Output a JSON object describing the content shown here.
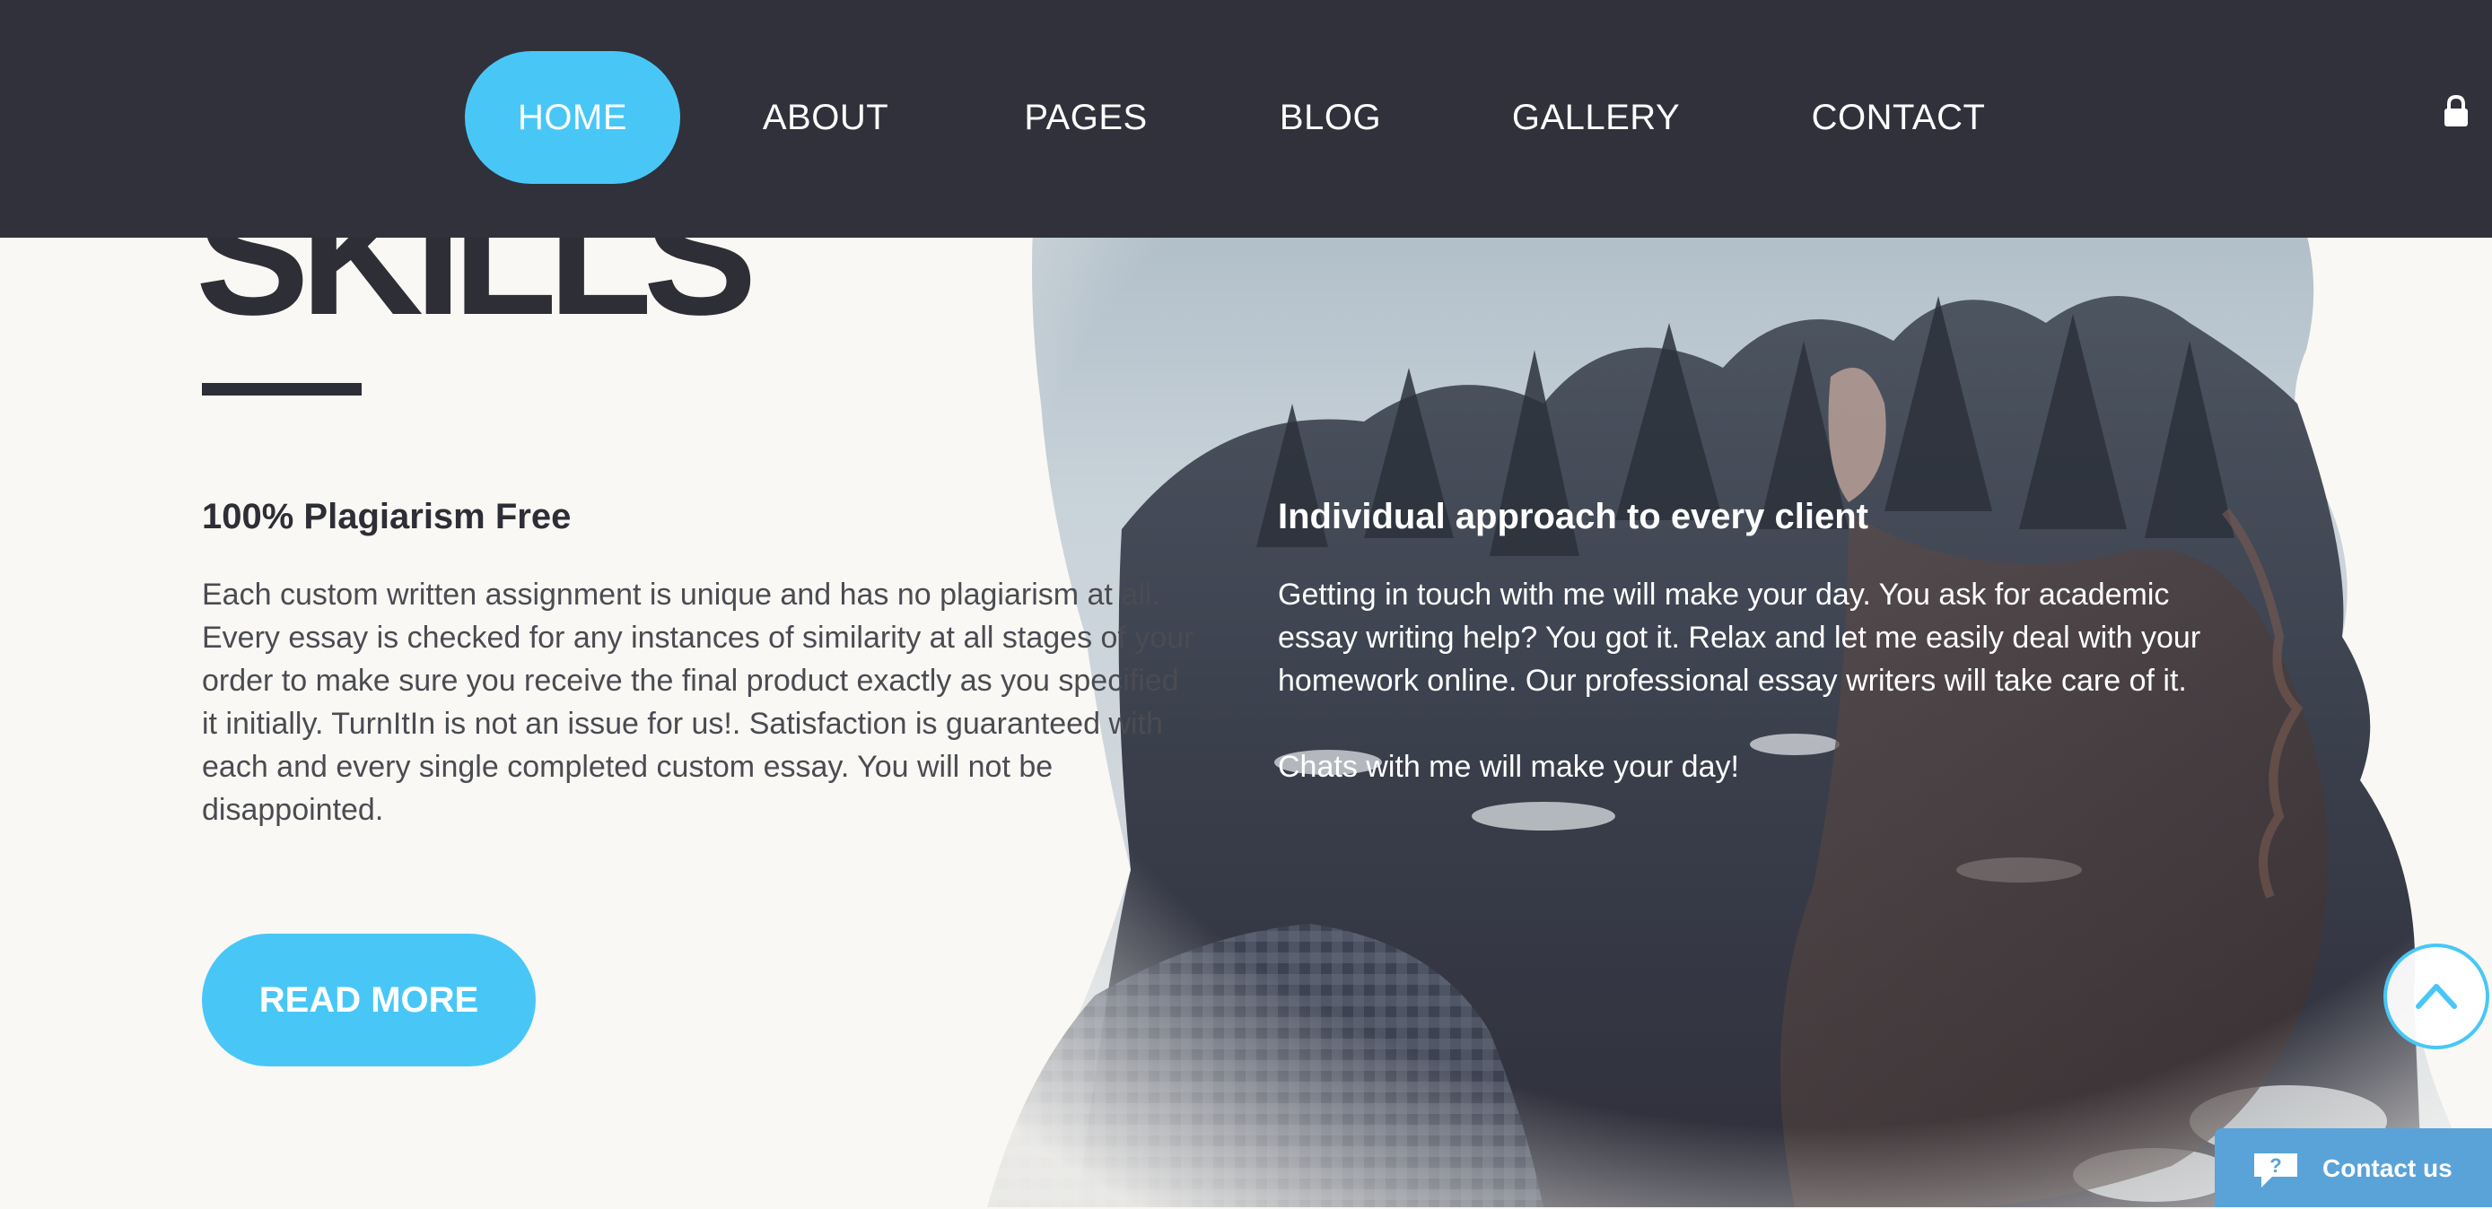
{
  "nav": {
    "items": [
      {
        "label": "HOME",
        "active": true
      },
      {
        "label": "ABOUT",
        "active": false
      },
      {
        "label": "PAGES",
        "active": false
      },
      {
        "label": "BLOG",
        "active": false
      },
      {
        "label": "GALLERY",
        "active": false
      },
      {
        "label": "CONTACT",
        "active": false
      }
    ],
    "lock_icon": "lock-icon"
  },
  "section": {
    "title": "SKILLS"
  },
  "columns": {
    "left": {
      "heading": "100% Plagiarism Free",
      "text": "Each custom written assignment is unique and has no plagiarism at all. Every essay is checked for any instances of similarity at all stages of your order to make sure you receive the final product exactly as you specified it initially. TurnItIn is not an issue for us!. Satisfaction is guaranteed with each and every single completed custom essay. You will not be disappointed."
    },
    "right": {
      "heading": "Individual approach to every client",
      "text": "Getting in touch with me will make your day. You ask for academic essay writing help? You got it. Relax and let me easily deal with your homework online. Our professional essay writers will take care of it.",
      "text2": "Chats with me will make your day!"
    }
  },
  "cta": {
    "read_more": "READ MORE"
  },
  "widgets": {
    "scroll_top_icon": "chevron-up-icon",
    "contact_label": "Contact us",
    "contact_icon": "chat-bubble-icon"
  },
  "colors": {
    "nav_bg": "#31313b",
    "accent": "#48c7f7",
    "page_bg": "#f9f8f4",
    "heading": "#2e2e36",
    "body_text": "#4b4b52",
    "contact_bg": "#5aa3d8"
  }
}
